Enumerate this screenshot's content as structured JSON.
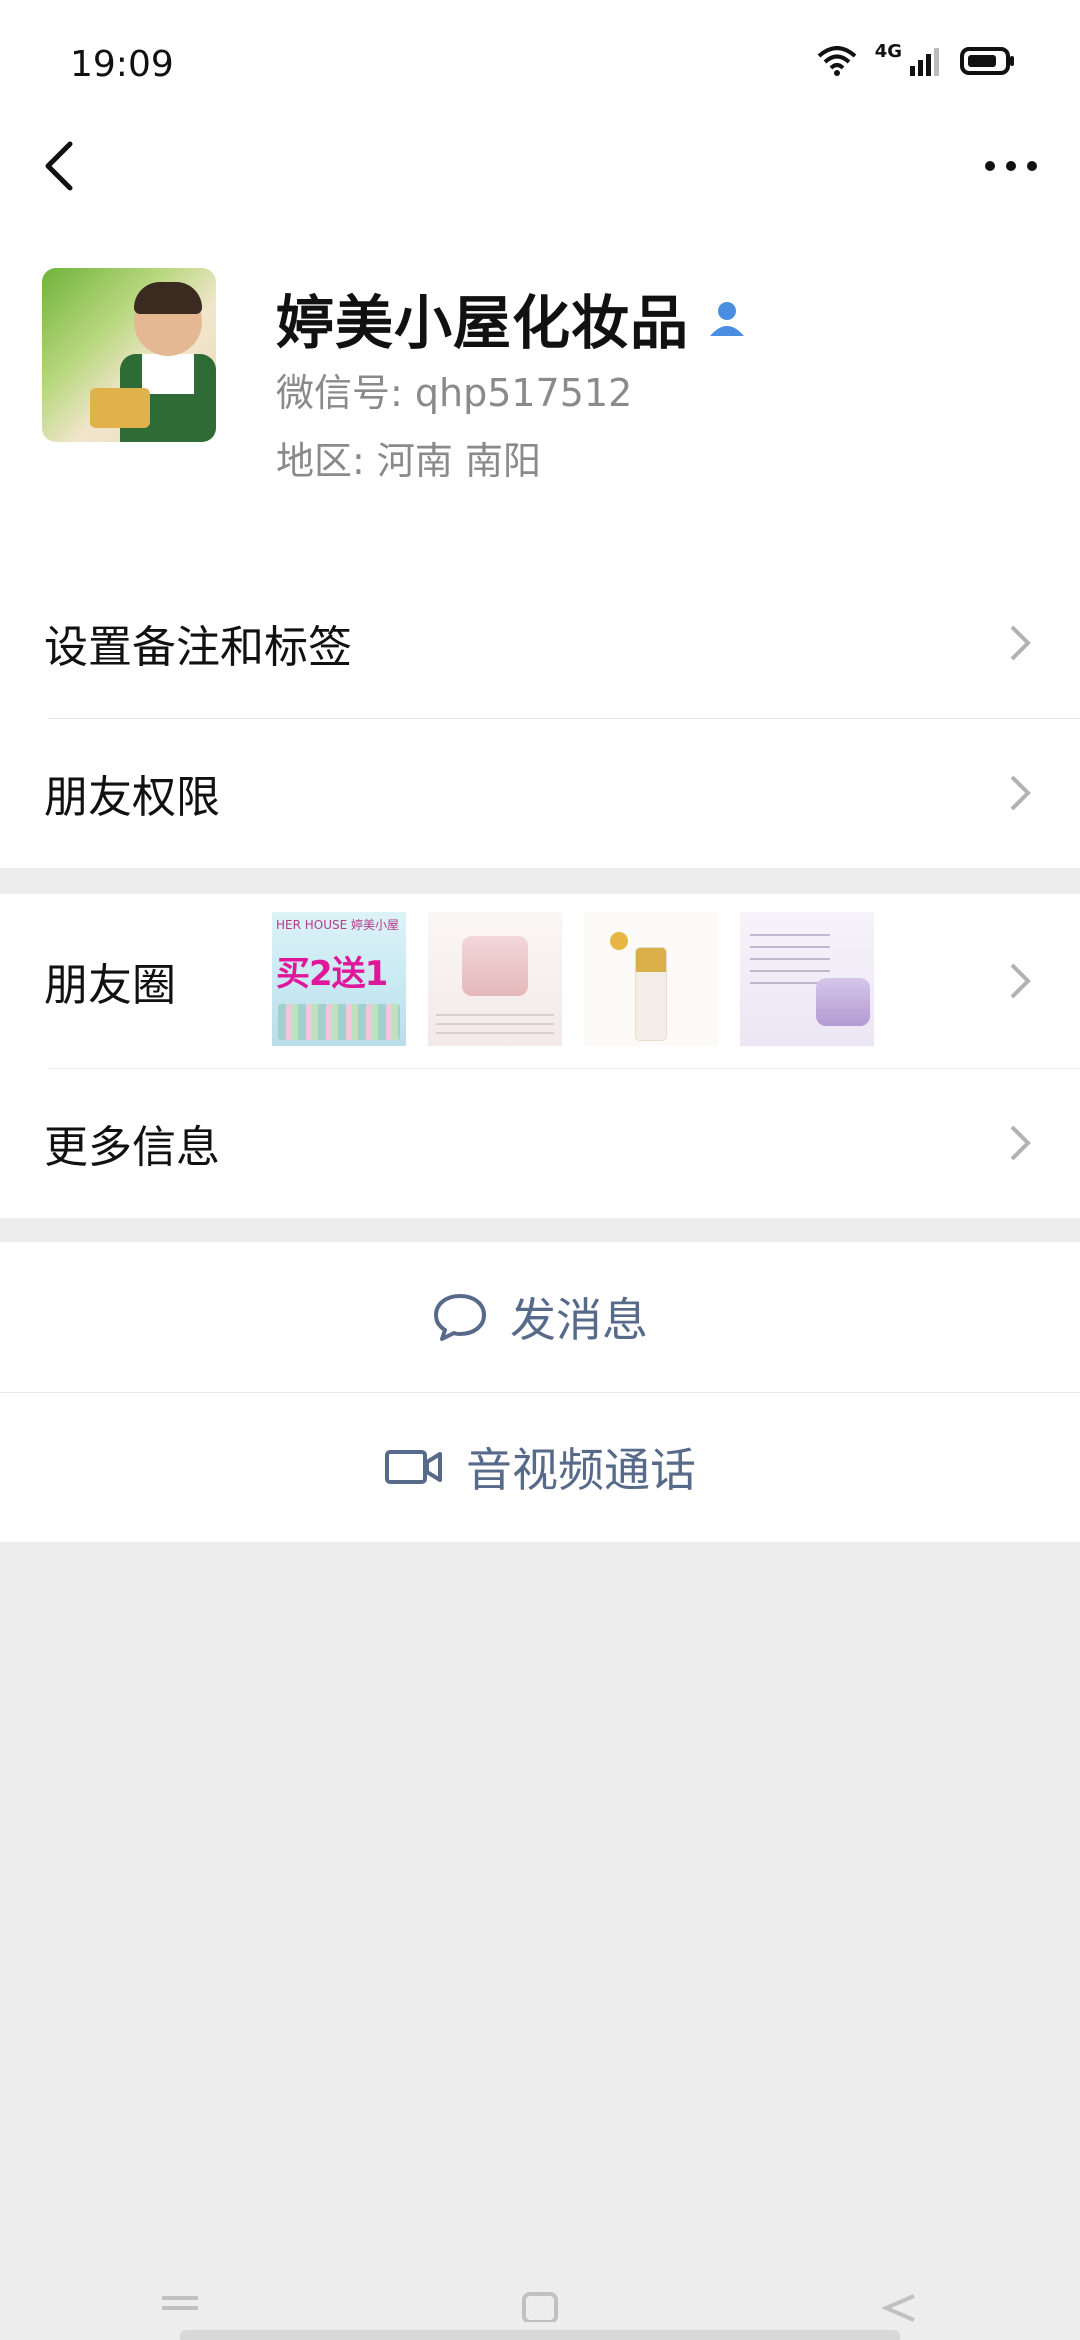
{
  "status_bar": {
    "time": "19:09",
    "network": "4G",
    "icons": [
      "wifi-icon",
      "signal-icon",
      "battery-icon"
    ]
  },
  "nav": {
    "back_icon": "back-arrow-icon",
    "more_icon": "more-dots-icon"
  },
  "profile": {
    "name": "婷美小屋化妆品",
    "verified_icon": "person-icon",
    "wechat_id": "微信号: qhp517512",
    "region": "地区: 河南  南阳"
  },
  "menu": {
    "set_remark": "设置备注和标签",
    "friend_permissions": "朋友权限",
    "moments": "朋友圈",
    "more_info": "更多信息"
  },
  "moments_thumbs": {
    "thumb1_brand": "HER HOUSE 婷美小屋",
    "thumb1_promo": "买2送1"
  },
  "actions": {
    "send_message": "发消息",
    "video_call": "音视频通话"
  },
  "colors": {
    "accent_link": "#586a89",
    "verified_blue": "#4a8ee0",
    "background": "#ededed"
  }
}
